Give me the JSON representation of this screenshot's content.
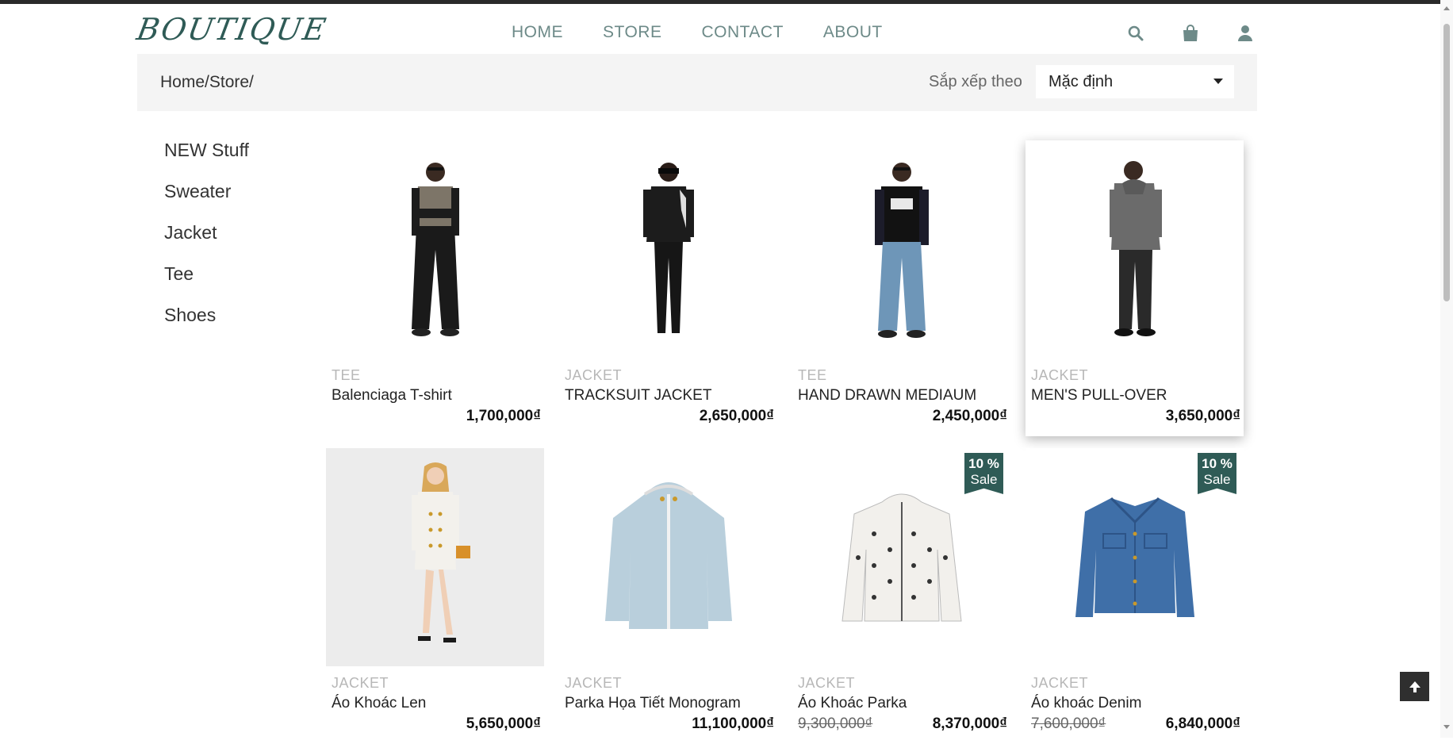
{
  "brand": {
    "logo": "BOUTIQUE",
    "accent": "#2f5b56"
  },
  "nav": [
    "HOME",
    "STORE",
    "CONTACT",
    "ABOUT"
  ],
  "header_icons": [
    "search-icon",
    "shopping-bag-icon",
    "user-icon"
  ],
  "breadcrumb": [
    "Home/",
    "Store/"
  ],
  "sort": {
    "label": "Sắp xếp theo",
    "selected": "Mặc định"
  },
  "categories": [
    "NEW Stuff",
    "Sweater",
    "Jacket",
    "Tee",
    "Shoes"
  ],
  "products": [
    {
      "category": "TEE",
      "name": "Balenciaga T-shirt",
      "price": "1,700,000₫"
    },
    {
      "category": "JACKET",
      "name": "TRACKSUIT JACKET",
      "price": "2,650,000₫"
    },
    {
      "category": "TEE",
      "name": "HAND DRAWN MEDIAUM",
      "price": "2,450,000₫"
    },
    {
      "category": "JACKET",
      "name": "MEN'S PULL-OVER",
      "price": "3,650,000₫"
    },
    {
      "category": "JACKET",
      "name": "Áo Khoác Len",
      "price": "5,650,000₫"
    },
    {
      "category": "JACKET",
      "name": "Parka Họa Tiết Monogram",
      "price": "11,100,000₫"
    },
    {
      "category": "JACKET",
      "name": "Áo Khoác Parka",
      "old_price": "9,300,000₫",
      "price": "8,370,000₫",
      "badge_percent": "10 %",
      "badge_label": "Sale"
    },
    {
      "category": "JACKET",
      "name": "Áo khoác Denim",
      "old_price": "7,600,000₫",
      "price": "6,840,000₫",
      "badge_percent": "10 %",
      "badge_label": "Sale"
    }
  ]
}
